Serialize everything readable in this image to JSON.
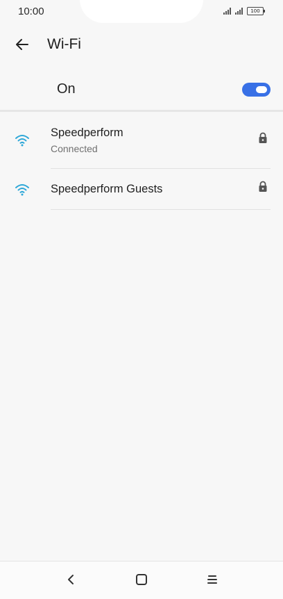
{
  "status_bar": {
    "time": "10:00",
    "battery": "100"
  },
  "header": {
    "title": "Wi-Fi",
    "back_icon": "arrow-left-icon"
  },
  "wifi_toggle": {
    "label": "On",
    "state": "on",
    "accent_color": "#3870e6"
  },
  "networks": [
    {
      "name": "Speedperform",
      "status": "Connected",
      "icon": "wifi-icon",
      "secured": true
    },
    {
      "name": "Speedperform Guests",
      "icon": "wifi-icon",
      "secured": true
    }
  ],
  "nav_bar": {
    "back_icon": "chevron-left-icon",
    "home_icon": "square-home-icon",
    "menu_icon": "menu-lines-icon"
  },
  "colors": {
    "wifi_icon": "#2fa8d8",
    "background": "#f7f7f7"
  }
}
